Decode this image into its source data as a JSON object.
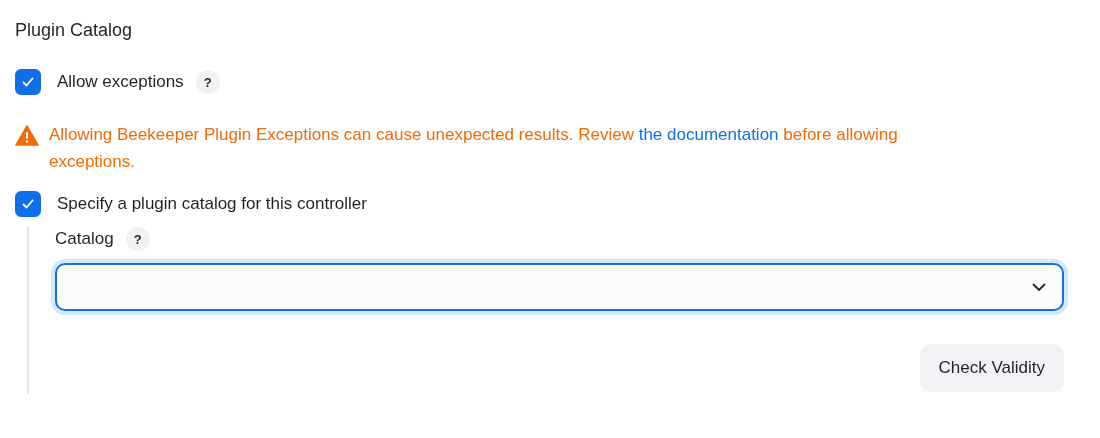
{
  "section_title": "Plugin Catalog",
  "allow_exceptions": {
    "label": "Allow exceptions",
    "checked": true,
    "help": "?"
  },
  "warning": {
    "before": "Allowing Beekeeper Plugin Exceptions can cause unexpected results. Review ",
    "link": "the documentation",
    "after": " before allowing exceptions."
  },
  "specify_catalog": {
    "label": "Specify a plugin catalog for this controller",
    "checked": true
  },
  "catalog": {
    "label": "Catalog",
    "help": "?",
    "focused": true
  },
  "buttons": [
    "Check Validity"
  ]
}
